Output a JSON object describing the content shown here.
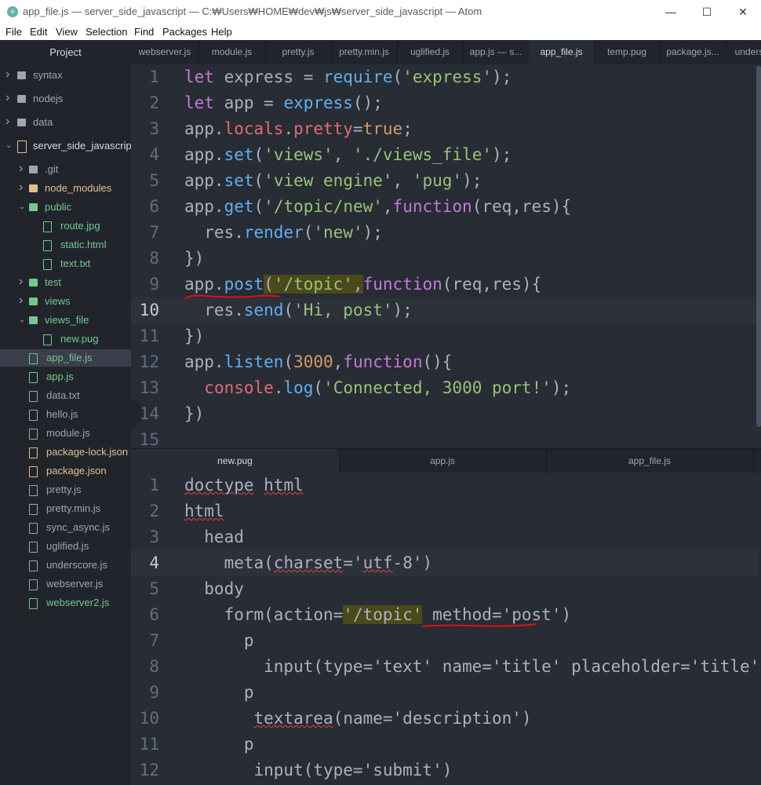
{
  "window": {
    "title": "app_file.js — server_side_javascript — C:₩Users₩HOME₩dev₩js₩server_side_javascript — Atom",
    "app_icon": "atom-icon",
    "controls": {
      "minimize": "—",
      "maximize": "☐",
      "close": "✕"
    }
  },
  "menu": [
    "File",
    "Edit",
    "View",
    "Selection",
    "Find",
    "Packages",
    "Help"
  ],
  "sidebar": {
    "title": "Project",
    "items": [
      {
        "label": "syntax",
        "kind": "folder",
        "expanded": false,
        "depth": 0
      },
      {
        "label": "nodejs",
        "kind": "folder",
        "expanded": false,
        "depth": 0
      },
      {
        "label": "data",
        "kind": "folder",
        "expanded": false,
        "depth": 0
      },
      {
        "label": "server_side_javascript",
        "kind": "repo",
        "expanded": true,
        "depth": 0
      },
      {
        "label": ".git",
        "kind": "folder",
        "expanded": false,
        "depth": 1
      },
      {
        "label": "node_modules",
        "kind": "folder-yellow",
        "expanded": false,
        "depth": 1
      },
      {
        "label": "public",
        "kind": "folder-green",
        "expanded": true,
        "depth": 1
      },
      {
        "label": "route.jpg",
        "kind": "file-green",
        "depth": 2
      },
      {
        "label": "static.html",
        "kind": "file-green",
        "depth": 2
      },
      {
        "label": "text.txt",
        "kind": "file-green",
        "depth": 2
      },
      {
        "label": "test",
        "kind": "folder-green",
        "expanded": false,
        "depth": 1
      },
      {
        "label": "views",
        "kind": "folder-green",
        "expanded": false,
        "depth": 1
      },
      {
        "label": "views_file",
        "kind": "folder-green",
        "expanded": true,
        "depth": 1
      },
      {
        "label": "new.pug",
        "kind": "file-green",
        "depth": 2
      },
      {
        "label": "app_file.js",
        "kind": "file-green",
        "depth": 1,
        "selected": true
      },
      {
        "label": "app.js",
        "kind": "file-green",
        "depth": 1
      },
      {
        "label": "data.txt",
        "kind": "file",
        "depth": 1
      },
      {
        "label": "hello.js",
        "kind": "file",
        "depth": 1
      },
      {
        "label": "module.js",
        "kind": "file",
        "depth": 1
      },
      {
        "label": "package-lock.json",
        "kind": "file-yellow",
        "depth": 1
      },
      {
        "label": "package.json",
        "kind": "file-yellow",
        "depth": 1
      },
      {
        "label": "pretty.js",
        "kind": "file",
        "depth": 1
      },
      {
        "label": "pretty.min.js",
        "kind": "file",
        "depth": 1
      },
      {
        "label": "sync_async.js",
        "kind": "file",
        "depth": 1
      },
      {
        "label": "uglified.js",
        "kind": "file",
        "depth": 1
      },
      {
        "label": "underscore.js",
        "kind": "file",
        "depth": 1
      },
      {
        "label": "webserver.js",
        "kind": "file",
        "depth": 1
      },
      {
        "label": "webserver2.js",
        "kind": "file-green",
        "depth": 1
      }
    ]
  },
  "top_tabs": [
    {
      "label": "webserver.js"
    },
    {
      "label": "module.js"
    },
    {
      "label": "pretty.js"
    },
    {
      "label": "pretty.min.js"
    },
    {
      "label": "uglified.js"
    },
    {
      "label": "app.js — s..."
    },
    {
      "label": "app_file.js",
      "active": true
    },
    {
      "label": "temp.pug"
    },
    {
      "label": "package.js..."
    },
    {
      "label": "unders"
    }
  ],
  "bottom_tabs": [
    {
      "label": "new.pug",
      "active": true
    },
    {
      "label": "app.js"
    },
    {
      "label": "app_file.js"
    }
  ],
  "top_editor": {
    "cursor_line": 10,
    "lines": [
      [
        [
          "kw",
          "let"
        ],
        [
          "p",
          " express = "
        ],
        [
          "fn",
          "require"
        ],
        [
          "p",
          "("
        ],
        [
          "str",
          "'express'"
        ],
        [
          "p",
          ");"
        ]
      ],
      [
        [
          "kw",
          "let"
        ],
        [
          "p",
          " app = "
        ],
        [
          "fn",
          "express"
        ],
        [
          "p",
          "();"
        ]
      ],
      [
        [
          "p",
          "app."
        ],
        [
          "prop",
          "locals"
        ],
        [
          "p",
          "."
        ],
        [
          "prop",
          "pretty"
        ],
        [
          "p",
          "="
        ],
        [
          "num",
          "true"
        ],
        [
          "p",
          ";"
        ]
      ],
      [
        [
          "p",
          "app."
        ],
        [
          "fn",
          "set"
        ],
        [
          "p",
          "("
        ],
        [
          "str",
          "'views'"
        ],
        [
          "p",
          ", "
        ],
        [
          "str",
          "'./views_file'"
        ],
        [
          "p",
          ");"
        ]
      ],
      [
        [
          "p",
          "app."
        ],
        [
          "fn",
          "set"
        ],
        [
          "p",
          "("
        ],
        [
          "str",
          "'view engine'"
        ],
        [
          "p",
          ", "
        ],
        [
          "str",
          "'pug'"
        ],
        [
          "p",
          ");"
        ]
      ],
      [
        [
          "p",
          "app."
        ],
        [
          "fn",
          "get"
        ],
        [
          "p",
          "("
        ],
        [
          "str",
          "'/topic/new'"
        ],
        [
          "p",
          ","
        ],
        [
          "kw",
          "function"
        ],
        [
          "p",
          "(req,res){"
        ]
      ],
      [
        [
          "p",
          "  res."
        ],
        [
          "fn",
          "render"
        ],
        [
          "p",
          "("
        ],
        [
          "str",
          "'new'"
        ],
        [
          "p",
          ");"
        ]
      ],
      [
        [
          "p",
          "})"
        ]
      ],
      [
        [
          "p",
          "app."
        ],
        [
          "fn",
          "post"
        ],
        [
          "hl",
          "("
        ],
        [
          "hl-str",
          "'/topic'"
        ],
        [
          "hl",
          ","
        ],
        [
          "kw",
          "function"
        ],
        [
          "p",
          "(req,res){"
        ]
      ],
      [
        [
          "p",
          "  res."
        ],
        [
          "fn",
          "send"
        ],
        [
          "p",
          "("
        ],
        [
          "str",
          "'Hi, post'"
        ],
        [
          "p",
          ");"
        ]
      ],
      [
        [
          "p",
          "})"
        ]
      ],
      [
        [
          "p",
          "app."
        ],
        [
          "fn",
          "listen"
        ],
        [
          "p",
          "("
        ],
        [
          "num",
          "3000"
        ],
        [
          "p",
          ","
        ],
        [
          "kw",
          "function"
        ],
        [
          "p",
          "(){"
        ]
      ],
      [
        [
          "p",
          "  "
        ],
        [
          "prop",
          "console"
        ],
        [
          "p",
          "."
        ],
        [
          "fn",
          "log"
        ],
        [
          "p",
          "("
        ],
        [
          "str",
          "'Connected, 3000 port!'"
        ],
        [
          "p",
          ");"
        ]
      ],
      [
        [
          "p",
          "})"
        ]
      ],
      []
    ]
  },
  "bottom_editor": {
    "cursor_line": 4,
    "lines": [
      [
        [
          "w",
          "doctype"
        ],
        [
          "p",
          " "
        ],
        [
          "w",
          "html"
        ]
      ],
      [
        [
          "w",
          "html"
        ]
      ],
      [
        [
          "p",
          "  head"
        ]
      ],
      [
        [
          "p",
          "    meta("
        ],
        [
          "w",
          "charset"
        ],
        [
          "p",
          "='"
        ],
        [
          "w",
          "utf"
        ],
        [
          "p",
          "-8')"
        ]
      ],
      [
        [
          "p",
          "  body"
        ]
      ],
      [
        [
          "p",
          "    form(action="
        ],
        [
          "hl",
          "'/topic'"
        ],
        [
          "p",
          " method='post')"
        ]
      ],
      [
        [
          "p",
          "      p"
        ]
      ],
      [
        [
          "p",
          "        input(type='text' name='title' placeholder='title')"
        ]
      ],
      [
        [
          "p",
          "      p"
        ]
      ],
      [
        [
          "p",
          "       "
        ],
        [
          "w",
          "textarea"
        ],
        [
          "p",
          "(name='description')"
        ]
      ],
      [
        [
          "p",
          "      p"
        ]
      ],
      [
        [
          "p",
          "       input(type='submit')"
        ]
      ]
    ]
  },
  "colors": {
    "editor_bg": "#282c34",
    "sidebar_bg": "#21252b",
    "annotation_red": "#e0101a"
  }
}
